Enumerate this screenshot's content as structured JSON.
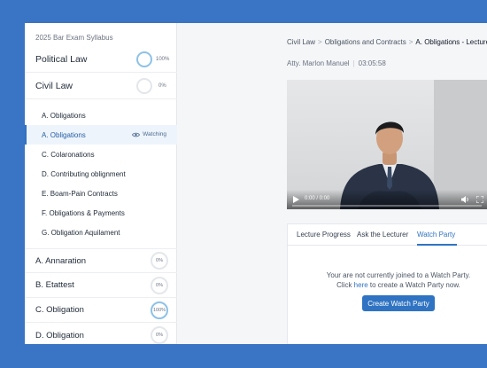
{
  "sidebar": {
    "course_title": "2025 Bar Exam Syllabus",
    "top_subjects": [
      {
        "label": "Political Law",
        "progress": "100%"
      },
      {
        "label": "Civil Law",
        "progress": "0%"
      }
    ],
    "lessons": [
      {
        "label": "A. Obligations"
      },
      {
        "label": "A. Obligations",
        "status": "Watching"
      },
      {
        "label": "C. Colaronations"
      },
      {
        "label": "D. Contributing oblignment"
      },
      {
        "label": "E. Boam-Pain Contracts"
      },
      {
        "label": "F. Obligations & Payments"
      },
      {
        "label": "G. Obligation Aquilament"
      }
    ],
    "bottom_subjects": [
      {
        "label": "A. Annaration",
        "progress": "0%"
      },
      {
        "label": "B. Etattest",
        "progress": "0%"
      },
      {
        "label": "C. Obligation",
        "progress": "100%"
      },
      {
        "label": "D. Obligation",
        "progress": "0%"
      }
    ]
  },
  "breadcrumb": {
    "items": [
      "Civil Law",
      "Obligations and Contracts"
    ],
    "current": "A. Obligations - Lecture"
  },
  "lecture": {
    "lecturer": "Atty. Marlon Manuel",
    "duration": "03:05:58"
  },
  "player": {
    "time": "0:00 / 0:00",
    "playback_position": 0
  },
  "tabs": [
    {
      "label": "Lecture Progress"
    },
    {
      "label": "Ask the Lecturer"
    },
    {
      "label": "Watch Party"
    }
  ],
  "active_tab": "Watch Party",
  "watch_party": {
    "message_line1": "Your are not currently joined to a Watch Party.",
    "message_prefix": "Click ",
    "message_link": "here",
    "message_suffix": " to create a Watch Party now.",
    "button_label": "Create Watch Party"
  },
  "colors": {
    "accent": "#2f73c2",
    "outer_background": "#3a74c4",
    "progress_ring": "#8ec2e6"
  }
}
